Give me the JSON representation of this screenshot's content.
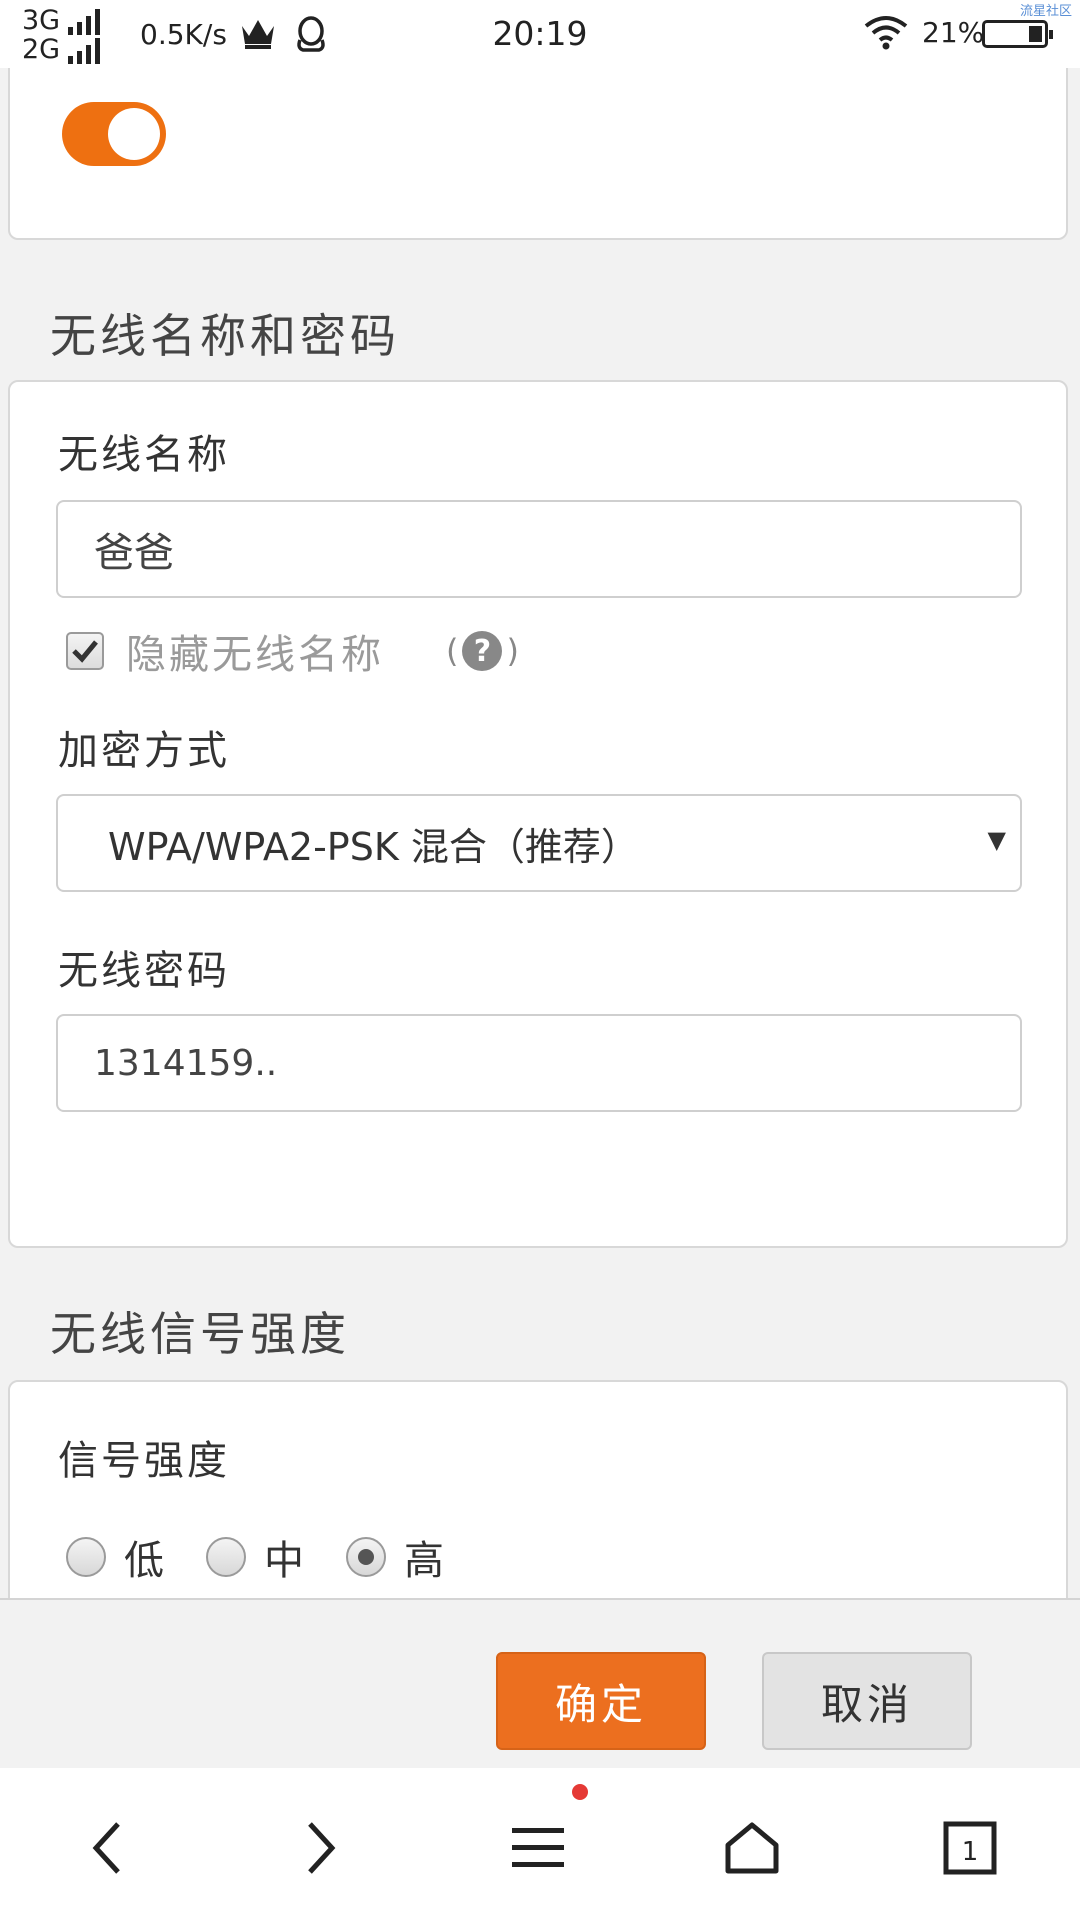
{
  "status_bar": {
    "network_top": "3G",
    "network_bottom": "2G",
    "speed": "0.5K/s",
    "time": "20:19",
    "battery": "21%",
    "watermark": "流星社区"
  },
  "wireless_toggle": {
    "on": true
  },
  "name_password_section": {
    "title": "无线名称和密码",
    "name_label": "无线名称",
    "name_value": "爸爸",
    "hide_name_label": "隐藏无线名称",
    "hide_name_checked": true,
    "help_open": "(",
    "help_symbol": "?",
    "help_close": ")",
    "encryption_label": "加密方式",
    "encryption_value": "WPA/WPA2-PSK 混合（推荐）",
    "password_label": "无线密码",
    "password_value": "1314159.."
  },
  "signal_section": {
    "title": "无线信号强度",
    "label": "信号强度",
    "options": [
      "低",
      "中",
      "高"
    ],
    "selected": "高"
  },
  "actions": {
    "ok_label": "确定",
    "cancel_label": "取消"
  },
  "browser_nav": {
    "icons": [
      "back-icon",
      "forward-icon",
      "menu-icon",
      "home-icon",
      "tabs-icon"
    ],
    "tab_count": "1"
  }
}
